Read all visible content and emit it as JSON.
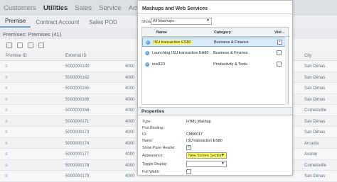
{
  "topnav": {
    "items": [
      "Customers",
      "Utilities",
      "Sales",
      "Service",
      "Activities"
    ]
  },
  "subtabs": [
    "Premise",
    "Contract Account",
    "Sales POD"
  ],
  "list_title": "Premises: Premises (41)",
  "table": {
    "headers": [
      "Premise ID",
      "External ID",
      "",
      "City"
    ],
    "rows": [
      {
        "pid": "",
        "ext": "5000000183",
        "mid": "4000",
        "city": "San Dimas"
      },
      {
        "pid": "",
        "ext": "5000000162",
        "mid": "4000",
        "city": "San Dimas"
      },
      {
        "pid": "",
        "ext": "5000000165",
        "mid": "4000",
        "city": "San Dimas"
      },
      {
        "pid": "",
        "ext": "5000000166",
        "mid": "4000",
        "city": "San Dimas"
      },
      {
        "pid": "",
        "ext": "5000000168",
        "mid": "4000",
        "city": "Cornelsville"
      },
      {
        "pid": "",
        "ext": "5000000171",
        "mid": "4000",
        "city": "San Dimas"
      },
      {
        "pid": "",
        "ext": "5000000173",
        "mid": "4000",
        "city": "San Dimas"
      },
      {
        "pid": "",
        "ext": "5000000174",
        "mid": "4000",
        "city": "Arcadia"
      },
      {
        "pid": "",
        "ext": "5000000177",
        "mid": "4000",
        "city": "Avalon"
      },
      {
        "pid": "",
        "ext": "5000000178",
        "mid": "4000",
        "city": "Cornelsville"
      },
      {
        "pid": "",
        "ext": "5000000179",
        "mid": "4000",
        "city": "San Dimas"
      }
    ]
  },
  "dialog": {
    "title": "Mashups and Web Services",
    "show_label": "Show:",
    "show_value": "All Mashups",
    "columns": [
      "Name",
      "Category",
      "Visi..."
    ],
    "mashups": [
      {
        "name": "ISU transaction ES80",
        "category": "Business & Finance",
        "visible": true,
        "selected": true
      },
      {
        "name": "Launching ISU transaction EA80",
        "category": "Business & Finance",
        "visible": false,
        "selected": false
      },
      {
        "name": "test123",
        "category": "Productivity & Tools",
        "visible": false,
        "selected": false
      }
    ],
    "properties_title": "Properties",
    "properties": {
      "type_label": "Type:",
      "type_value": "HTML Mashup",
      "port_label": "Port Binding:",
      "port_value": "",
      "id_label": "ID:",
      "id_value": "CM00017",
      "name_label": "Name:",
      "name_value": "ISU transaction ES80",
      "pane_label": "Show Pane Header:",
      "appearance_label": "Appearance:",
      "appearance_value": "New Screen Section",
      "toggle_label": "Toggle Display:",
      "toggle_value": "",
      "fullwidth_label": "Full Width:"
    }
  }
}
